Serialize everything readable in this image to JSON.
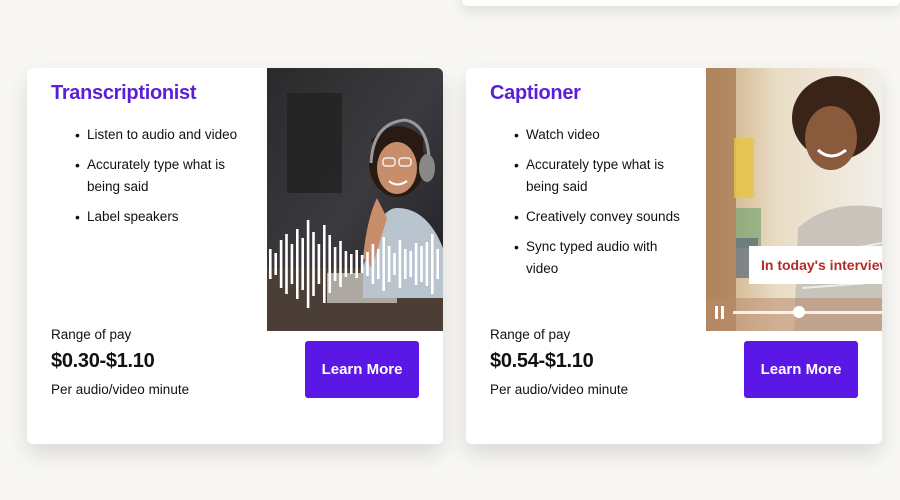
{
  "cards": [
    {
      "title": "Transcriptionist",
      "bullets": [
        "Listen to audio and video",
        "Accurately type what is being said",
        "Label speakers"
      ],
      "pay_label": "Range of pay",
      "pay_range": "$0.30-$1.10",
      "pay_unit": "Per audio/video minute",
      "button": "Learn More",
      "image_icon": "audio-waveform-icon"
    },
    {
      "title": "Captioner",
      "bullets": [
        "Watch video",
        "Accurately type what is being said",
        "Creatively convey sounds",
        "Sync typed audio with video"
      ],
      "pay_label": "Range of pay",
      "pay_range": "$0.54-$1.10",
      "pay_unit": "Per audio/video minute",
      "button": "Learn More",
      "caption_text": "In today's interview,",
      "player_icons": [
        "pause-icon",
        "seek-handle-icon"
      ]
    }
  ],
  "colors": {
    "accent": "#5a17e6",
    "title": "#5b1fd6",
    "caption": "#b52a2a"
  }
}
